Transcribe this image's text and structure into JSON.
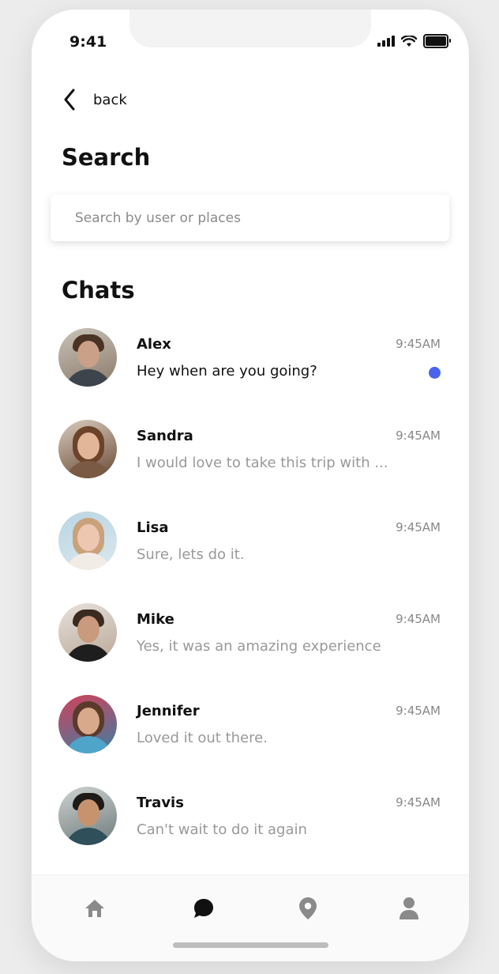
{
  "status_bar": {
    "time": "9:41"
  },
  "header": {
    "back_label": "back"
  },
  "search": {
    "title": "Search",
    "placeholder": "Search by user or places"
  },
  "chats": {
    "title": "Chats",
    "items": [
      {
        "name": "Alex",
        "time": "9:45AM",
        "message": "Hey when are you going?",
        "unread": true
      },
      {
        "name": "Sandra",
        "time": "9:45AM",
        "message": "I would love to take this trip with ...",
        "unread": false
      },
      {
        "name": "Lisa",
        "time": "9:45AM",
        "message": "Sure, lets do it.",
        "unread": false
      },
      {
        "name": "Mike",
        "time": "9:45AM",
        "message": "Yes, it was an amazing experience",
        "unread": false
      },
      {
        "name": "Jennifer",
        "time": "9:45AM",
        "message": "Loved it out there.",
        "unread": false
      },
      {
        "name": "Travis",
        "time": "9:45AM",
        "message": "Can't wait to do it again",
        "unread": false
      }
    ]
  },
  "tab_bar": {
    "tabs": [
      {
        "icon": "home-icon",
        "active": false
      },
      {
        "icon": "chat-bubble-icon",
        "active": true
      },
      {
        "icon": "location-pin-icon",
        "active": false
      },
      {
        "icon": "profile-icon",
        "active": false
      }
    ]
  },
  "colors": {
    "unread_dot": "#4a63ee",
    "tab_active": "#111111",
    "tab_inactive": "#8a8a8a"
  }
}
